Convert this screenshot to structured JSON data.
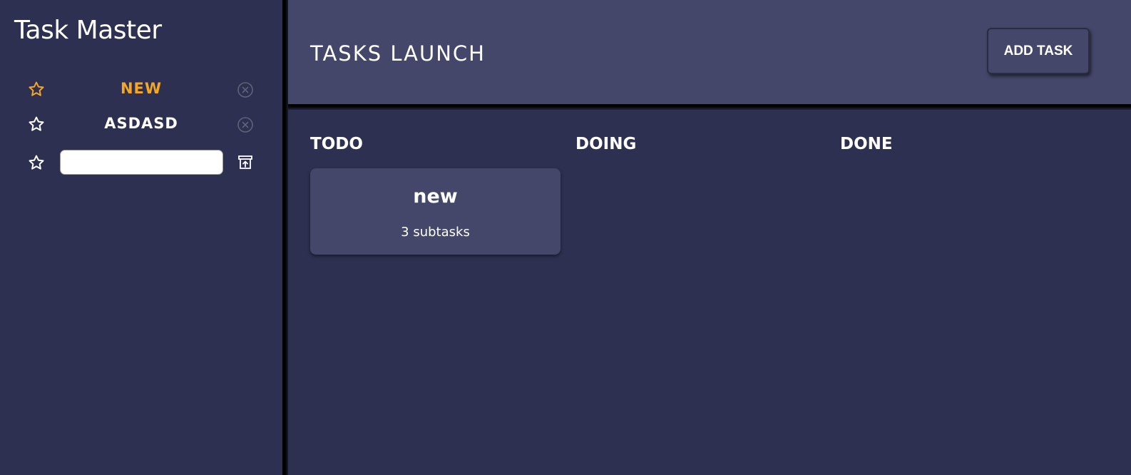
{
  "sidebar": {
    "app_title": "Task Master",
    "projects": [
      {
        "name": "NEW",
        "starred": true,
        "color": "#f5a623"
      },
      {
        "name": "ASDASD",
        "starred": false,
        "color": "#ffffff"
      }
    ],
    "new_project_input": {
      "value": "",
      "placeholder": ""
    }
  },
  "header": {
    "board_title": "TASKS LAUNCH",
    "add_task_label": "ADD TASK"
  },
  "board": {
    "columns": [
      {
        "title": "TODO"
      },
      {
        "title": "DOING"
      },
      {
        "title": "DONE"
      }
    ],
    "cards": [
      {
        "title": "new",
        "subtitle": "3 subtasks"
      }
    ]
  },
  "colors": {
    "sidebar_bg": "#2d3050",
    "header_bg": "#44476a",
    "accent": "#f5a623",
    "text": "#ffffff"
  }
}
